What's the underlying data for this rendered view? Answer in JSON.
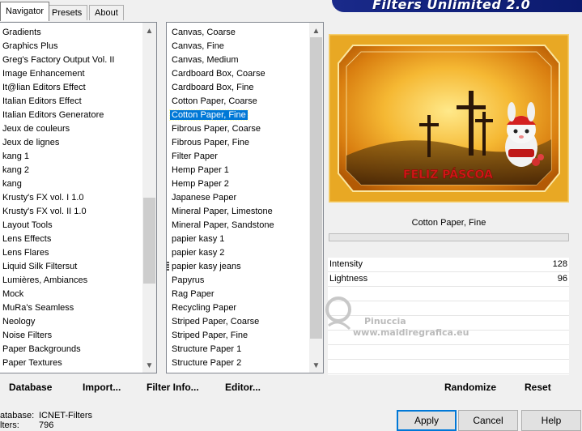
{
  "tabs": [
    "Navigator",
    "Presets",
    "About"
  ],
  "banner": "Filters Unlimited 2.0",
  "categories": [
    "Gradients",
    "Graphics Plus",
    "Greg's Factory Output Vol. II",
    "Image Enhancement",
    "It@lian Editors Effect",
    "Italian Editors Effect",
    "Italian Editors Generatore",
    "Jeux de couleurs",
    "Jeux de lignes",
    "kang 1",
    "kang 2",
    "kang",
    "Krusty's FX vol. I 1.0",
    "Krusty's FX vol. II 1.0",
    "Layout Tools",
    "Lens Effects",
    "Lens Flares",
    "Liquid Silk Filtersut",
    "Lumières, Ambiances",
    "Mock",
    "MuRa's Seamless",
    "Neology",
    "Noise Filters",
    "Paper Backgrounds",
    "Paper Textures"
  ],
  "filters": [
    "Canvas, Coarse",
    "Canvas, Fine",
    "Canvas, Medium",
    "Cardboard Box, Coarse",
    "Cardboard Box, Fine",
    "Cotton Paper, Coarse",
    "Cotton Paper, Fine",
    "Fibrous Paper, Coarse",
    "Fibrous Paper, Fine",
    "Filter Paper",
    "Hemp Paper 1",
    "Hemp Paper 2",
    "Japanese Paper",
    "Mineral Paper, Limestone",
    "Mineral Paper, Sandstone",
    "papier kasy 1",
    "papier kasy 2",
    "papier kasy jeans",
    "Papyrus",
    "Rag Paper",
    "Recycling Paper",
    "Striped Paper, Coarse",
    "Striped Paper, Fine",
    "Structure Paper 1",
    "Structure Paper 2"
  ],
  "preview": {
    "caption": "FELIZ PÁSCOA"
  },
  "selected_filter": "Cotton Paper, Fine",
  "params": [
    {
      "label": "Intensity",
      "value": "128"
    },
    {
      "label": "Lightness",
      "value": "96"
    }
  ],
  "watermark": {
    "brand": "Pinuccia",
    "url": "www.maidiregrafica.eu"
  },
  "toolbar": {
    "database": "Database",
    "import": "Import...",
    "filter_info": "Filter Info...",
    "editor": "Editor...",
    "randomize": "Randomize",
    "reset": "Reset"
  },
  "status": {
    "database_label": "atabase:",
    "database_value": "ICNET-Filters",
    "filters_label": "lters:",
    "filters_value": "796"
  },
  "buttons": {
    "apply": "Apply",
    "cancel": "Cancel",
    "help": "Help"
  },
  "colors": {
    "selection": "#0078d7",
    "banner": "#0b1a6e"
  }
}
